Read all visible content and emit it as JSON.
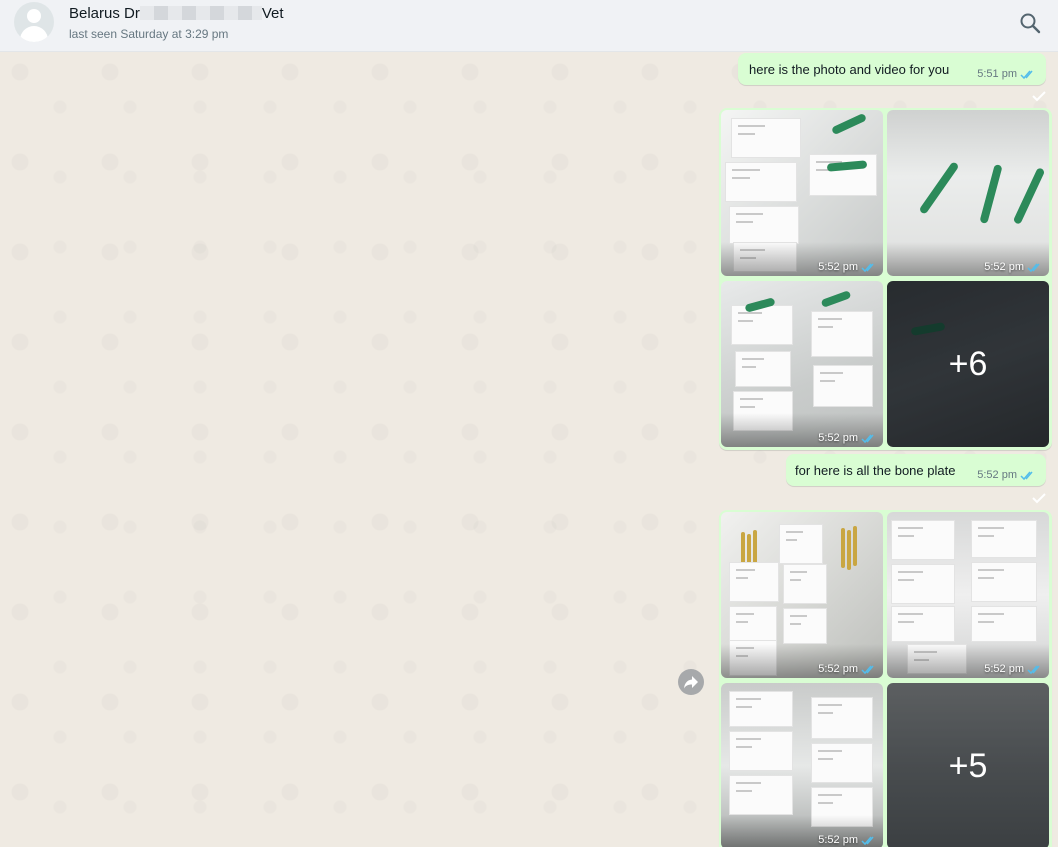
{
  "header": {
    "name_prefix": "Belarus Dr",
    "name_suffix": "Vet",
    "status": "last seen Saturday at 3:29 pm"
  },
  "icons": {
    "search": "search-icon",
    "avatar": "default-avatar-icon",
    "read_receipt": "double-check-icon",
    "forward": "forward-icon",
    "reaction": "react-icon"
  },
  "colors": {
    "outgoing_bubble": "#d9fdd3",
    "read_ticks": "#53bdeb",
    "chat_bg": "#efeae2"
  },
  "messages": [
    {
      "type": "text",
      "text": "here is the photo and video for you",
      "time": "5:51 pm"
    },
    {
      "type": "album",
      "tiles": [
        {
          "time": "5:52 pm"
        },
        {
          "time": "5:52 pm"
        },
        {
          "time": "5:52 pm"
        },
        {
          "more": "+6"
        }
      ]
    },
    {
      "type": "text",
      "text": "for here is all the bone plate",
      "time": "5:52 pm"
    },
    {
      "type": "album",
      "tiles": [
        {
          "time": "5:52 pm"
        },
        {
          "time": "5:52 pm"
        },
        {
          "time": "5:52 pm"
        },
        {
          "more": "+5"
        }
      ]
    }
  ]
}
